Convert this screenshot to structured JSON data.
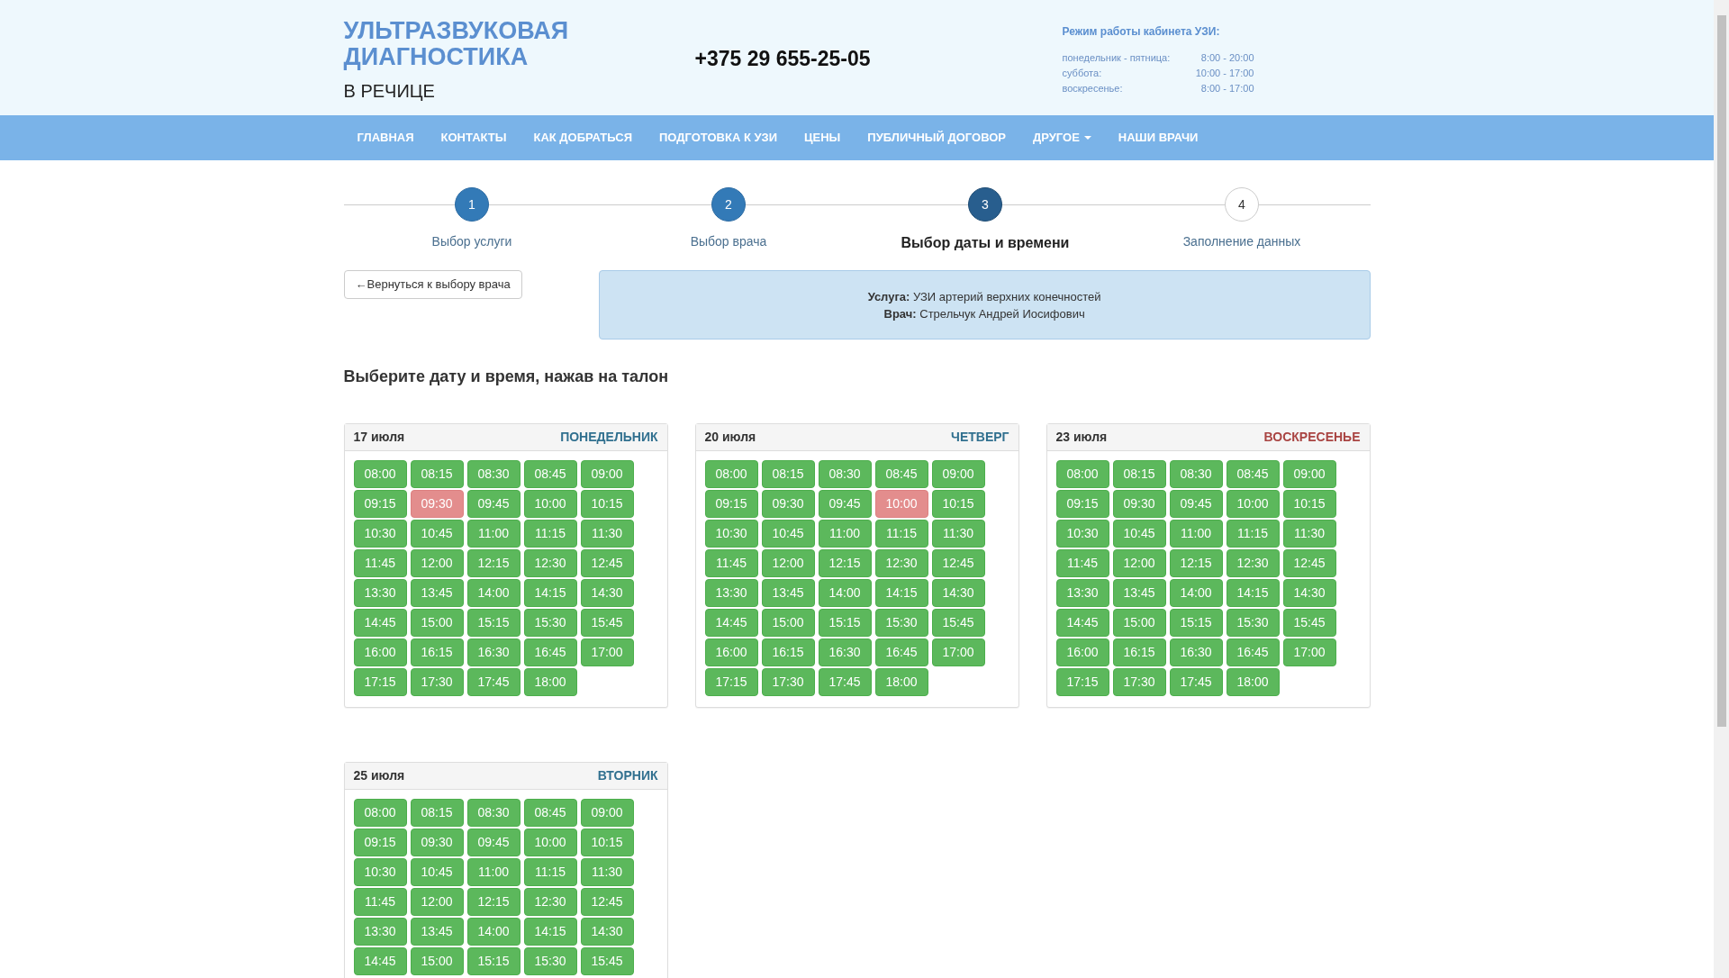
{
  "header": {
    "title_line1": "УЛЬТРАЗВУКОВАЯ",
    "title_line2": "ДИАГНОСТИКА",
    "subtitle": "В РЕЧИЦЕ",
    "phone": "+375 29 655-25-05",
    "hours_title": "Режим работы кабинета УЗИ:",
    "hours": [
      {
        "days": "понедельник - пятница:",
        "time": "8:00 - 20:00"
      },
      {
        "days": "суббота:",
        "time": "10:00 - 17:00"
      },
      {
        "days": "воскресенье:",
        "time": "8:00 - 17:00"
      }
    ]
  },
  "nav": [
    {
      "label": "ГЛАВНАЯ",
      "dropdown": false
    },
    {
      "label": "КОНТАКТЫ",
      "dropdown": false
    },
    {
      "label": "КАК ДОБРАТЬСЯ",
      "dropdown": false
    },
    {
      "label": "ПОДГОТОВКА К УЗИ",
      "dropdown": false
    },
    {
      "label": "ЦЕНЫ",
      "dropdown": false
    },
    {
      "label": "ПУБЛИЧНЫЙ ДОГОВОР",
      "dropdown": false
    },
    {
      "label": "ДРУГОЕ",
      "dropdown": true
    },
    {
      "label": "НАШИ ВРАЧИ",
      "dropdown": false
    }
  ],
  "steps": [
    {
      "number": "1",
      "label": "Выбор услуги",
      "kind": "done"
    },
    {
      "number": "2",
      "label": "Выбор врача",
      "kind": "done"
    },
    {
      "number": "3",
      "label": "Выбор даты и времени",
      "kind": "active"
    },
    {
      "number": "4",
      "label": "Заполнение данных",
      "kind": "pending"
    }
  ],
  "back_button": "←Вернуться к выбору врача",
  "info": {
    "service_label": "Услуга:",
    "service": "УЗИ артерий верхних конечностей",
    "doctor_label": "Врач:",
    "doctor": "Стрельчук Андрей Иосифович"
  },
  "heading": "Выберите дату и время, нажав на талон",
  "days": [
    {
      "date": "17 июля",
      "weekday": "ПОНЕДЕЛЬНИК",
      "color": "#31708f",
      "slots": [
        {
          "time": "08:00",
          "booked": false
        },
        {
          "time": "08:15",
          "booked": false
        },
        {
          "time": "08:30",
          "booked": false
        },
        {
          "time": "08:45",
          "booked": false
        },
        {
          "time": "09:00",
          "booked": false
        },
        {
          "time": "09:15",
          "booked": false
        },
        {
          "time": "09:30",
          "booked": true
        },
        {
          "time": "09:45",
          "booked": false
        },
        {
          "time": "10:00",
          "booked": false
        },
        {
          "time": "10:15",
          "booked": false
        },
        {
          "time": "10:30",
          "booked": false
        },
        {
          "time": "10:45",
          "booked": false
        },
        {
          "time": "11:00",
          "booked": false
        },
        {
          "time": "11:15",
          "booked": false
        },
        {
          "time": "11:30",
          "booked": false
        },
        {
          "time": "11:45",
          "booked": false
        },
        {
          "time": "12:00",
          "booked": false
        },
        {
          "time": "12:15",
          "booked": false
        },
        {
          "time": "12:30",
          "booked": false
        },
        {
          "time": "12:45",
          "booked": false
        },
        {
          "time": "13:30",
          "booked": false
        },
        {
          "time": "13:45",
          "booked": false
        },
        {
          "time": "14:00",
          "booked": false
        },
        {
          "time": "14:15",
          "booked": false
        },
        {
          "time": "14:30",
          "booked": false
        },
        {
          "time": "14:45",
          "booked": false
        },
        {
          "time": "15:00",
          "booked": false
        },
        {
          "time": "15:15",
          "booked": false
        },
        {
          "time": "15:30",
          "booked": false
        },
        {
          "time": "15:45",
          "booked": false
        },
        {
          "time": "16:00",
          "booked": false
        },
        {
          "time": "16:15",
          "booked": false
        },
        {
          "time": "16:30",
          "booked": false
        },
        {
          "time": "16:45",
          "booked": false
        },
        {
          "time": "17:00",
          "booked": false
        },
        {
          "time": "17:15",
          "booked": false
        },
        {
          "time": "17:30",
          "booked": false
        },
        {
          "time": "17:45",
          "booked": false
        },
        {
          "time": "18:00",
          "booked": false
        }
      ]
    },
    {
      "date": "20 июля",
      "weekday": "ЧЕТВЕРГ",
      "color": "#31708f",
      "slots": [
        {
          "time": "08:00",
          "booked": false
        },
        {
          "time": "08:15",
          "booked": false
        },
        {
          "time": "08:30",
          "booked": false
        },
        {
          "time": "08:45",
          "booked": false
        },
        {
          "time": "09:00",
          "booked": false
        },
        {
          "time": "09:15",
          "booked": false
        },
        {
          "time": "09:30",
          "booked": false
        },
        {
          "time": "09:45",
          "booked": false
        },
        {
          "time": "10:00",
          "booked": true
        },
        {
          "time": "10:15",
          "booked": false
        },
        {
          "time": "10:30",
          "booked": false
        },
        {
          "time": "10:45",
          "booked": false
        },
        {
          "time": "11:00",
          "booked": false
        },
        {
          "time": "11:15",
          "booked": false
        },
        {
          "time": "11:30",
          "booked": false
        },
        {
          "time": "11:45",
          "booked": false
        },
        {
          "time": "12:00",
          "booked": false
        },
        {
          "time": "12:15",
          "booked": false
        },
        {
          "time": "12:30",
          "booked": false
        },
        {
          "time": "12:45",
          "booked": false
        },
        {
          "time": "13:30",
          "booked": false
        },
        {
          "time": "13:45",
          "booked": false
        },
        {
          "time": "14:00",
          "booked": false
        },
        {
          "time": "14:15",
          "booked": false
        },
        {
          "time": "14:30",
          "booked": false
        },
        {
          "time": "14:45",
          "booked": false
        },
        {
          "time": "15:00",
          "booked": false
        },
        {
          "time": "15:15",
          "booked": false
        },
        {
          "time": "15:30",
          "booked": false
        },
        {
          "time": "15:45",
          "booked": false
        },
        {
          "time": "16:00",
          "booked": false
        },
        {
          "time": "16:15",
          "booked": false
        },
        {
          "time": "16:30",
          "booked": false
        },
        {
          "time": "16:45",
          "booked": false
        },
        {
          "time": "17:00",
          "booked": false
        },
        {
          "time": "17:15",
          "booked": false
        },
        {
          "time": "17:30",
          "booked": false
        },
        {
          "time": "17:45",
          "booked": false
        },
        {
          "time": "18:00",
          "booked": false
        }
      ]
    },
    {
      "date": "23 июля",
      "weekday": "ВОСКРЕСЕНЬЕ",
      "color": "#a94442",
      "slots": [
        {
          "time": "08:00",
          "booked": false
        },
        {
          "time": "08:15",
          "booked": false
        },
        {
          "time": "08:30",
          "booked": false
        },
        {
          "time": "08:45",
          "booked": false
        },
        {
          "time": "09:00",
          "booked": false
        },
        {
          "time": "09:15",
          "booked": false
        },
        {
          "time": "09:30",
          "booked": false
        },
        {
          "time": "09:45",
          "booked": false
        },
        {
          "time": "10:00",
          "booked": false
        },
        {
          "time": "10:15",
          "booked": false
        },
        {
          "time": "10:30",
          "booked": false
        },
        {
          "time": "10:45",
          "booked": false
        },
        {
          "time": "11:00",
          "booked": false
        },
        {
          "time": "11:15",
          "booked": false
        },
        {
          "time": "11:30",
          "booked": false
        },
        {
          "time": "11:45",
          "booked": false
        },
        {
          "time": "12:00",
          "booked": false
        },
        {
          "time": "12:15",
          "booked": false
        },
        {
          "time": "12:30",
          "booked": false
        },
        {
          "time": "12:45",
          "booked": false
        },
        {
          "time": "13:30",
          "booked": false
        },
        {
          "time": "13:45",
          "booked": false
        },
        {
          "time": "14:00",
          "booked": false
        },
        {
          "time": "14:15",
          "booked": false
        },
        {
          "time": "14:30",
          "booked": false
        },
        {
          "time": "14:45",
          "booked": false
        },
        {
          "time": "15:00",
          "booked": false
        },
        {
          "time": "15:15",
          "booked": false
        },
        {
          "time": "15:30",
          "booked": false
        },
        {
          "time": "15:45",
          "booked": false
        },
        {
          "time": "16:00",
          "booked": false
        },
        {
          "time": "16:15",
          "booked": false
        },
        {
          "time": "16:30",
          "booked": false
        },
        {
          "time": "16:45",
          "booked": false
        },
        {
          "time": "17:00",
          "booked": false
        },
        {
          "time": "17:15",
          "booked": false
        },
        {
          "time": "17:30",
          "booked": false
        },
        {
          "time": "17:45",
          "booked": false
        },
        {
          "time": "18:00",
          "booked": false
        }
      ]
    },
    {
      "date": "25 июля",
      "weekday": "ВТОРНИК",
      "color": "#31708f",
      "slots": [
        {
          "time": "08:00",
          "booked": false
        },
        {
          "time": "08:15",
          "booked": false
        },
        {
          "time": "08:30",
          "booked": false
        },
        {
          "time": "08:45",
          "booked": false
        },
        {
          "time": "09:00",
          "booked": false
        },
        {
          "time": "09:15",
          "booked": false
        },
        {
          "time": "09:30",
          "booked": false
        },
        {
          "time": "09:45",
          "booked": false
        },
        {
          "time": "10:00",
          "booked": false
        },
        {
          "time": "10:15",
          "booked": false
        },
        {
          "time": "10:30",
          "booked": false
        },
        {
          "time": "10:45",
          "booked": false
        },
        {
          "time": "11:00",
          "booked": false
        },
        {
          "time": "11:15",
          "booked": false
        },
        {
          "time": "11:30",
          "booked": false
        },
        {
          "time": "11:45",
          "booked": false
        },
        {
          "time": "12:00",
          "booked": false
        },
        {
          "time": "12:15",
          "booked": false
        },
        {
          "time": "12:30",
          "booked": false
        },
        {
          "time": "12:45",
          "booked": false
        },
        {
          "time": "13:30",
          "booked": false
        },
        {
          "time": "13:45",
          "booked": false
        },
        {
          "time": "14:00",
          "booked": false
        },
        {
          "time": "14:15",
          "booked": false
        },
        {
          "time": "14:30",
          "booked": false
        },
        {
          "time": "14:45",
          "booked": false
        },
        {
          "time": "15:00",
          "booked": false
        },
        {
          "time": "15:15",
          "booked": false
        },
        {
          "time": "15:30",
          "booked": false
        },
        {
          "time": "15:45",
          "booked": false
        }
      ]
    }
  ]
}
